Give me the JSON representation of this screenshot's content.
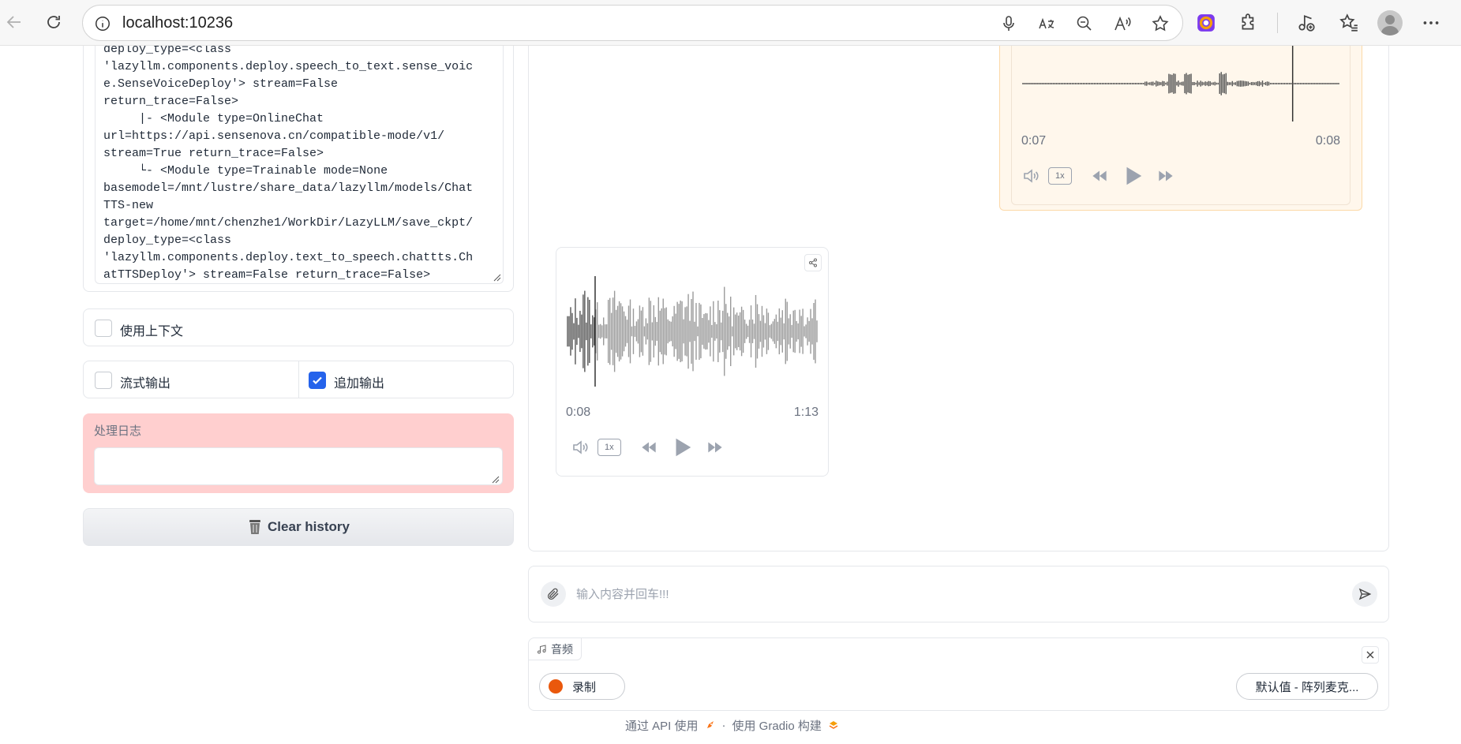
{
  "browser": {
    "url": "localhost:10236"
  },
  "left": {
    "code_lines": [
      "deploy_type=<class",
      "'lazyllm.components.deploy.speech_to_text.sense_voic",
      "e.SenseVoiceDeploy'> stream=False",
      "return_trace=False>",
      "     |- <Module type=OnlineChat",
      "url=https://api.sensenova.cn/compatible-mode/v1/",
      "stream=True return_trace=False>",
      "     └- <Module type=Trainable mode=None",
      "basemodel=/mnt/lustre/share_data/lazyllm/models/Chat",
      "TTS-new",
      "target=/home/mnt/chenzhe1/WorkDir/LazyLLM/save_ckpt/",
      "deploy_type=<class",
      "'lazyllm.components.deploy.text_to_speech.chattts.Ch",
      "atTTSDeploy'> stream=False return_trace=False>"
    ],
    "use_context_label": "使用上下文",
    "use_context_checked": false,
    "stream_output_label": "流式输出",
    "stream_output_checked": false,
    "append_output_label": "追加输出",
    "append_output_checked": true,
    "log_label": "处理日志",
    "log_value": "",
    "clear_history_label": "Clear history"
  },
  "chat": {
    "user_audio": {
      "current_time": "0:07",
      "duration": "0:08",
      "speed": "1x",
      "progress": 0.85
    },
    "bot_audio": {
      "current_time": "0:08",
      "duration": "1:13",
      "speed": "1x",
      "progress": 0.11
    }
  },
  "input": {
    "placeholder": "输入内容并回车!!!"
  },
  "audio_input": {
    "tab_label": "音频",
    "record_label": "录制",
    "device_label": "默认值 - 阵列麦克..."
  },
  "footer": {
    "api_text": "通过 API 使用",
    "separator": "·",
    "gradio_text": "使用 Gradio 构建"
  },
  "colors": {
    "accent_blue": "#2563eb",
    "record_orange": "#ea580c",
    "log_bg": "#ffcfcf",
    "user_bubble_bg": "#fff7ec"
  }
}
